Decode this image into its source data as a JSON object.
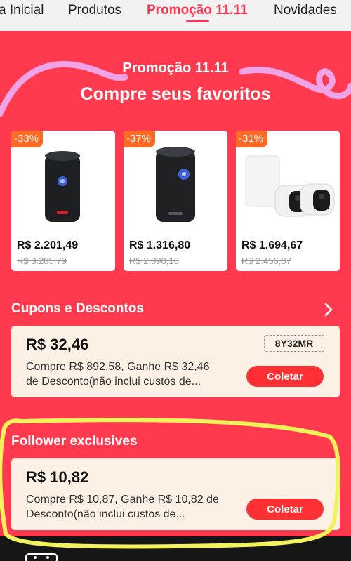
{
  "nav": {
    "tabs": [
      {
        "label": "a Inicial"
      },
      {
        "label": "Produtos"
      },
      {
        "label": "Promoção 11.11"
      },
      {
        "label": "Novidades"
      }
    ]
  },
  "promo": {
    "kicker": "Promoção 11.11",
    "headline": "Compre seus favoritos"
  },
  "products": [
    {
      "discount": "-33%",
      "price": "R$ 2.201,49",
      "old_price": "R$ 3.285,79"
    },
    {
      "discount": "-37%",
      "price": "R$ 1.316,80",
      "old_price": "R$ 2.090,16"
    },
    {
      "discount": "-31%",
      "price": "R$ 1.694,67",
      "old_price": "R$ 2.456,07"
    }
  ],
  "coupons_section": {
    "title": "Cupons e Descontos",
    "card": {
      "amount": "R$ 32,46",
      "code": "8Y32MR",
      "desc_line1": "Compre R$ 892,58, Ganhe R$ 32,46",
      "desc_line2": "de Desconto(não inclui custos de...",
      "button": "Coletar"
    }
  },
  "follower_section": {
    "title": "Follower exclusives",
    "card": {
      "amount": "R$ 10,82",
      "desc_line1": "Compre R$ 10,87, Ganhe R$ 10,82 de",
      "desc_line2": "Desconto(não inclui custos de...",
      "button": "Coletar"
    }
  },
  "colors": {
    "brand": "#ff3a4e",
    "discount_badge": "#ff6a24",
    "button": "#ff3033",
    "coupon_bg": "#fdf1e6",
    "highlight": "#f2f25a"
  },
  "icons": {
    "section_more": "chevron-right-icon",
    "bottom_strip": "tv-icon"
  }
}
